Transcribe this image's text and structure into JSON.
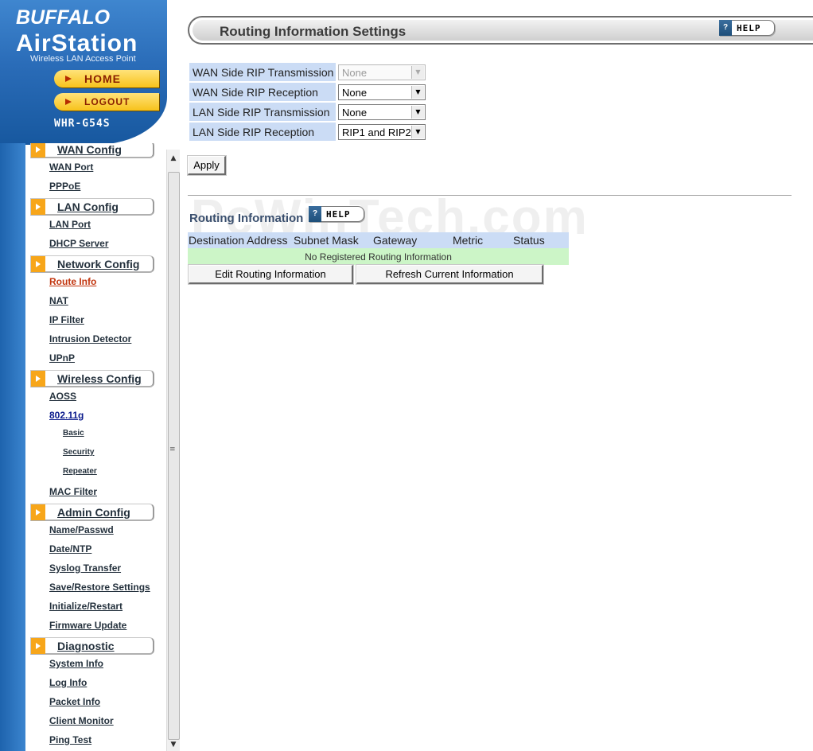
{
  "brand": {
    "name": "BUFFALO",
    "product": "AirStation",
    "subtitle": "Wireless LAN Access Point",
    "model": "WHR-G54S",
    "home_label": "HOME",
    "logout_label": "LOGOUT"
  },
  "nav": {
    "sections": [
      {
        "label": "WAN Config",
        "items": [
          {
            "label": "WAN Port"
          },
          {
            "label": "PPPoE"
          }
        ]
      },
      {
        "label": "LAN Config",
        "items": [
          {
            "label": "LAN Port"
          },
          {
            "label": "DHCP Server"
          }
        ]
      },
      {
        "label": "Network Config",
        "items": [
          {
            "label": "Route Info"
          },
          {
            "label": "NAT"
          },
          {
            "label": "IP Filter"
          },
          {
            "label": "Intrusion Detector"
          },
          {
            "label": "UPnP"
          }
        ]
      },
      {
        "label": "Wireless Config",
        "items": [
          {
            "label": "AOSS"
          },
          {
            "label": "802.11g"
          },
          {
            "label": "Basic"
          },
          {
            "label": "Security"
          },
          {
            "label": "Repeater"
          },
          {
            "label": "MAC Filter"
          }
        ]
      },
      {
        "label": "Admin Config",
        "items": [
          {
            "label": "Name/Passwd"
          },
          {
            "label": "Date/NTP"
          },
          {
            "label": "Syslog Transfer"
          },
          {
            "label": "Save/Restore Settings"
          },
          {
            "label": "Initialize/Restart"
          },
          {
            "label": "Firmware Update"
          }
        ]
      },
      {
        "label": "Diagnostic",
        "items": [
          {
            "label": "System Info"
          },
          {
            "label": "Log Info"
          },
          {
            "label": "Packet Info"
          },
          {
            "label": "Client Monitor"
          },
          {
            "label": "Ping Test"
          }
        ]
      }
    ]
  },
  "main": {
    "title": "Routing Information Settings",
    "help_label": "HELP",
    "rip_settings": [
      {
        "label": "WAN Side RIP Transmission",
        "value": "None"
      },
      {
        "label": "WAN Side RIP Reception",
        "value": "None"
      },
      {
        "label": "LAN Side RIP Transmission",
        "value": "None"
      },
      {
        "label": "LAN Side RIP Reception",
        "value": "RIP1 and RIP2"
      }
    ],
    "apply_label": "Apply",
    "watermark": "PcWinTech.com",
    "routing_title": "Routing Information",
    "routing_help_label": "HELP",
    "columns": [
      "Destination Address",
      "Subnet Mask",
      "Gateway",
      "Metric",
      "Status"
    ],
    "empty_message": "No Registered Routing Information",
    "edit_label": "Edit Routing Information",
    "refresh_label": "Refresh Current Information"
  },
  "icons": {
    "help": "question-mark-icon",
    "nav_bullet": "orange-arrow-icon",
    "dropdown": "chevron-down-icon"
  }
}
